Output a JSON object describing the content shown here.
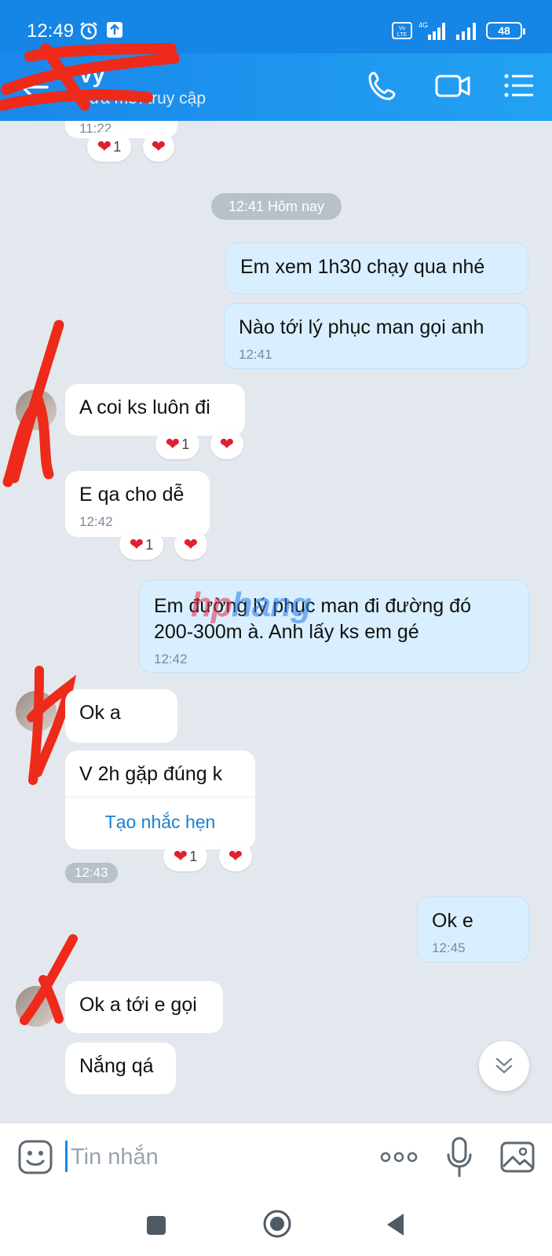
{
  "status": {
    "time": "12:49",
    "network": "4G",
    "volte": "Vo LTE",
    "battery": "48"
  },
  "header": {
    "contact_name": "Vy",
    "subtitle": "Vừa mới truy cập"
  },
  "chat": {
    "top_time": "11:22",
    "date_divider": "12:41 Hôm nay",
    "messages": [
      {
        "dir": "out",
        "text": "Em xem 1h30 chạy qua nhé",
        "time": ""
      },
      {
        "dir": "out",
        "text": "Nào tới lý phục man gọi anh",
        "time": "12:41"
      },
      {
        "dir": "in",
        "text": "A coi ks luôn đi",
        "time": ""
      },
      {
        "dir": "in",
        "text": "E qa cho dễ",
        "time": "12:42"
      },
      {
        "dir": "out",
        "text": "Em đường lý phục man đi đường đó 200-300m à. Anh lấy ks em gé",
        "time": "12:42"
      },
      {
        "dir": "in",
        "text": "Ok a",
        "time": ""
      },
      {
        "dir": "in",
        "text": "V 2h gặp đúng k",
        "time": "",
        "action": "Tạo nhắc hẹn"
      },
      {
        "dir": "out",
        "text": "Ok e",
        "time": "12:45"
      },
      {
        "dir": "in",
        "text": "Ok a tới e gọi",
        "time": ""
      },
      {
        "dir": "in",
        "text": "Nắng qá",
        "time": ""
      }
    ],
    "group_time": "12:43",
    "reaction_count": "1",
    "heart": "❤"
  },
  "watermark": {
    "part1": "hp",
    "part2": "hang"
  },
  "input": {
    "placeholder": "Tin nhắn"
  },
  "colors": {
    "brand": "#1585e6",
    "chat_bg": "#e3e8ee",
    "out_bubble": "#d9efff",
    "link": "#1c7fd3",
    "heart": "#e0202f",
    "redaction": "#ee2a1a"
  }
}
